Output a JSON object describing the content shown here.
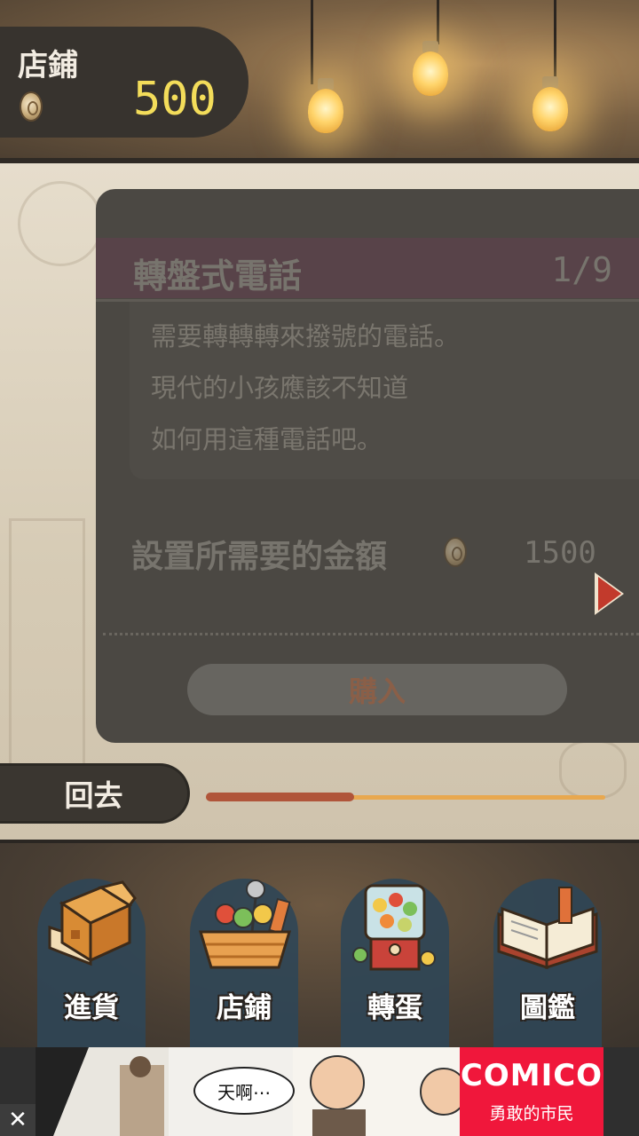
{
  "header": {
    "title": "店鋪",
    "money": "500",
    "coin_icon": "coin-icon"
  },
  "item": {
    "name": "轉盤式電話",
    "page_counter": "1/9",
    "description": [
      "需要轉轉轉來撥號的電話。",
      "現代的小孩應該不知道",
      "如何用這種電話吧。"
    ],
    "cost_label": "設置所需要的金額",
    "cost_value": "1500",
    "buy_label": "購入",
    "next_icon": "next-arrow-icon"
  },
  "back_label": "回去",
  "progress": 0.37,
  "colors": {
    "panel": "#4b4843",
    "header_bar": "#584349",
    "money": "#f3dd5a",
    "next_arrow": "#c23a2c",
    "nav_arch": "#2f4657",
    "ad_brand": "#f0173b",
    "progress_fill": "#b0553a",
    "progress_track": "#e8a84f"
  },
  "nav": [
    {
      "label": "進貨",
      "icon": "cardboard-box-icon"
    },
    {
      "label": "店鋪",
      "icon": "candy-basket-icon"
    },
    {
      "label": "轉蛋",
      "icon": "gacha-machine-icon"
    },
    {
      "label": "圖鑑",
      "icon": "open-book-icon"
    }
  ],
  "ad": {
    "speech": "天啊⋯",
    "brand": "COMICO",
    "tagline": "勇敢的市民",
    "close": "✕"
  }
}
